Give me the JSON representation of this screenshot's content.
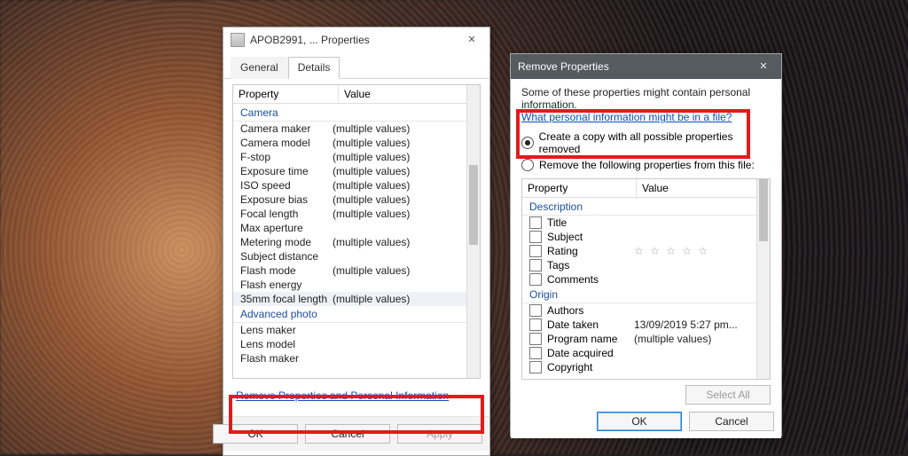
{
  "dlg1": {
    "title": "APOB2991, ... Properties",
    "tabs": {
      "general": "General",
      "details": "Details"
    },
    "cols": {
      "prop": "Property",
      "val": "Value"
    },
    "group_camera": "Camera",
    "group_advanced": "Advanced photo",
    "rows_camera": [
      {
        "p": "Camera maker",
        "v": "(multiple values)"
      },
      {
        "p": "Camera model",
        "v": "(multiple values)"
      },
      {
        "p": "F-stop",
        "v": "(multiple values)"
      },
      {
        "p": "Exposure time",
        "v": "(multiple values)"
      },
      {
        "p": "ISO speed",
        "v": "(multiple values)"
      },
      {
        "p": "Exposure bias",
        "v": "(multiple values)"
      },
      {
        "p": "Focal length",
        "v": "(multiple values)"
      },
      {
        "p": "Max aperture",
        "v": ""
      },
      {
        "p": "Metering mode",
        "v": "(multiple values)"
      },
      {
        "p": "Subject distance",
        "v": ""
      },
      {
        "p": "Flash mode",
        "v": "(multiple values)"
      },
      {
        "p": "Flash energy",
        "v": ""
      },
      {
        "p": "35mm focal length",
        "v": "(multiple values)"
      }
    ],
    "rows_adv": [
      {
        "p": "Lens maker",
        "v": ""
      },
      {
        "p": "Lens model",
        "v": ""
      },
      {
        "p": "Flash maker",
        "v": ""
      }
    ],
    "link": "Remove Properties and Personal Information",
    "ok": "OK",
    "cancel": "Cancel",
    "apply": "Apply"
  },
  "dlg2": {
    "title": "Remove Properties",
    "info": "Some of these properties might contain personal information.",
    "infolink": "What personal information might be in a file?",
    "r1": "Create a copy with all possible properties removed",
    "r2": "Remove the following properties from this file:",
    "cols": {
      "prop": "Property",
      "val": "Value"
    },
    "group_desc": "Description",
    "group_origin": "Origin",
    "rows_desc": [
      {
        "p": "Title",
        "v": ""
      },
      {
        "p": "Subject",
        "v": ""
      },
      {
        "p": "Rating",
        "v": "★★★★★",
        "stars": true
      },
      {
        "p": "Tags",
        "v": ""
      },
      {
        "p": "Comments",
        "v": ""
      }
    ],
    "rows_origin": [
      {
        "p": "Authors",
        "v": ""
      },
      {
        "p": "Date taken",
        "v": "13/09/2019 5:27 pm..."
      },
      {
        "p": "Program name",
        "v": "(multiple values)"
      },
      {
        "p": "Date acquired",
        "v": ""
      },
      {
        "p": "Copyright",
        "v": ""
      }
    ],
    "selectall": "Select All",
    "ok": "OK",
    "cancel": "Cancel"
  }
}
